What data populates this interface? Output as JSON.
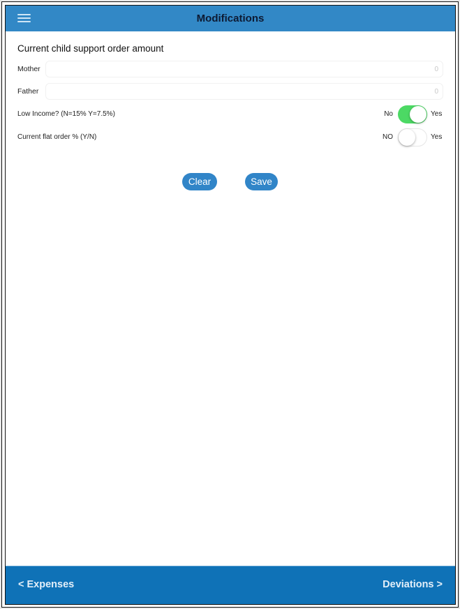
{
  "header": {
    "title": "Modifications",
    "menu_icon": "hamburger-menu-icon"
  },
  "form": {
    "section_title": "Current  child support order amount",
    "fields": [
      {
        "label": "Mother",
        "value": "",
        "placeholder": "0"
      },
      {
        "label": "Father",
        "value": "",
        "placeholder": "0"
      }
    ],
    "toggles": [
      {
        "label": "Low Income? (N=15% Y=7.5%)",
        "off_label": "No",
        "on_label": "Yes",
        "state": "on"
      },
      {
        "label": "Current flat order % (Y/N)",
        "off_label": "NO",
        "on_label": "Yes",
        "state": "off"
      }
    ]
  },
  "actions": {
    "clear_label": "Clear",
    "save_label": "Save"
  },
  "footer": {
    "prev_label": "< Expenses",
    "next_label": "Deviations >"
  },
  "colors": {
    "header_bg": "#3288c6",
    "footer_bg": "#0f72b7",
    "button_bg": "#3185c8",
    "toggle_on": "#4cd964"
  }
}
